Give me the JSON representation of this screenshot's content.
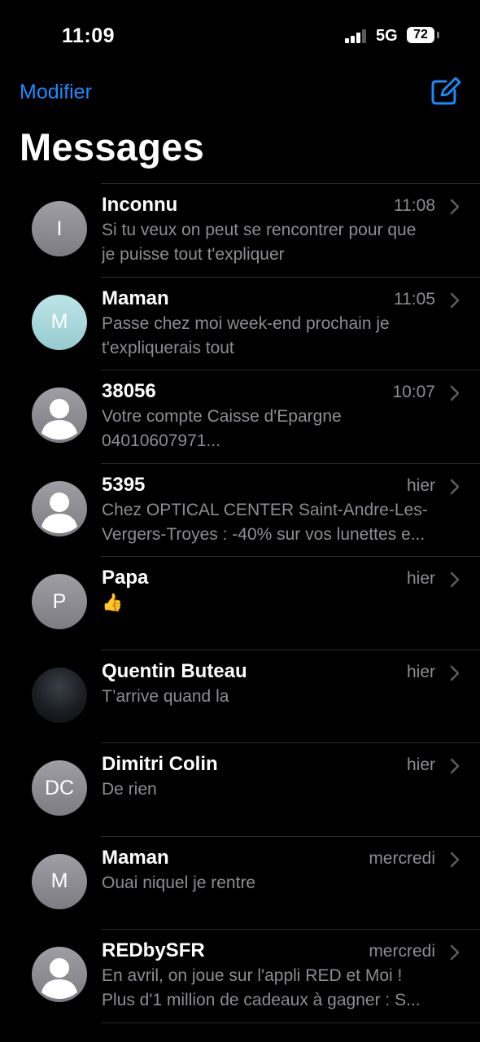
{
  "status_bar": {
    "time": "11:09",
    "network": "5G",
    "battery": "72"
  },
  "header": {
    "edit_label": "Modifier",
    "title": "Messages"
  },
  "conversations": [
    {
      "name": "Inconnu",
      "time": "11:08",
      "avatar_type": "letters",
      "avatar_text": "I",
      "preview": [
        "Si tu veux on peut se rencontrer pour que",
        "je puisse tout t'expliquer"
      ]
    },
    {
      "name": "Maman",
      "time": "11:05",
      "avatar_type": "letters-teal",
      "avatar_text": "M",
      "preview": [
        "Passe chez moi week-end prochain je",
        "t'expliquerais tout"
      ]
    },
    {
      "name": "38056",
      "time": "10:07",
      "avatar_type": "person-icon",
      "avatar_text": "",
      "preview": [
        "Votre compte Caisse d'Epargne",
        "04010607971..."
      ]
    },
    {
      "name": "5395",
      "time": "hier",
      "avatar_type": "person-icon",
      "avatar_text": "",
      "preview": [
        "Chez OPTICAL CENTER Saint-Andre-Les-",
        "Vergers-Troyes : -40% sur vos lunettes e..."
      ]
    },
    {
      "name": "Papa",
      "time": "hier",
      "avatar_type": "letters",
      "avatar_text": "P",
      "preview": [
        "👍",
        ""
      ]
    },
    {
      "name": "Quentin Buteau",
      "time": "hier",
      "avatar_type": "photo",
      "avatar_text": "",
      "preview": [
        "T’arrive quand la",
        ""
      ]
    },
    {
      "name": "Dimitri  Colin",
      "time": "hier",
      "avatar_type": "letters",
      "avatar_text": "DC",
      "preview": [
        "De rien",
        ""
      ]
    },
    {
      "name": "Maman",
      "time": "mercredi",
      "avatar_type": "letters",
      "avatar_text": "M",
      "preview": [
        "Ouai niquel je rentre",
        ""
      ]
    },
    {
      "name": "REDbySFR",
      "time": "mercredi",
      "avatar_type": "person-icon",
      "avatar_text": "",
      "preview": [
        "En avril, on joue sur l'appli RED et Moi !",
        "Plus d'1 million de cadeaux à gagner : S..."
      ]
    }
  ],
  "colors": {
    "accent": "#1a8cff",
    "background": "#000000",
    "secondary_text": "#8d8d93"
  }
}
